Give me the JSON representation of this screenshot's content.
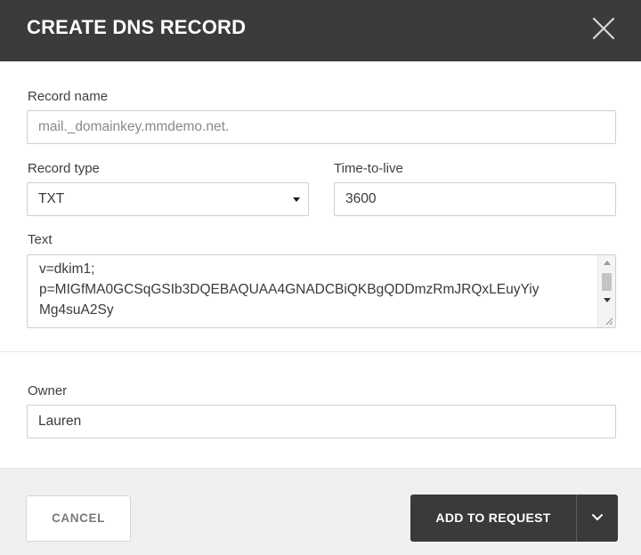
{
  "dialog": {
    "title": "CREATE DNS RECORD",
    "close_icon": "close-icon"
  },
  "form": {
    "record_name": {
      "label": "Record name",
      "value": "mail._domainkey.mmdemo.net."
    },
    "record_type": {
      "label": "Record type",
      "value": "TXT",
      "icon": "caret-down-icon"
    },
    "ttl": {
      "label": "Time-to-live",
      "value": "3600"
    },
    "text": {
      "label": "Text",
      "lines": [
        "v=dkim1;",
        "p=MIGfMA0GCSqGSIb3DQEBAQUAA4GNADCBiQKBgQDDmzRmJRQxLEuyYiy",
        "Mg4suA2Sy"
      ]
    },
    "owner": {
      "label": "Owner",
      "value": "Lauren"
    }
  },
  "footer": {
    "cancel_label": "CANCEL",
    "add_label": "ADD TO REQUEST",
    "add_menu_icon": "chevron-down-icon"
  },
  "colors": {
    "header_bg": "#3b3b3b",
    "primary_button": "#3a3a3a",
    "footer_bg": "#f0f0f0",
    "border": "#cfcfcf"
  }
}
